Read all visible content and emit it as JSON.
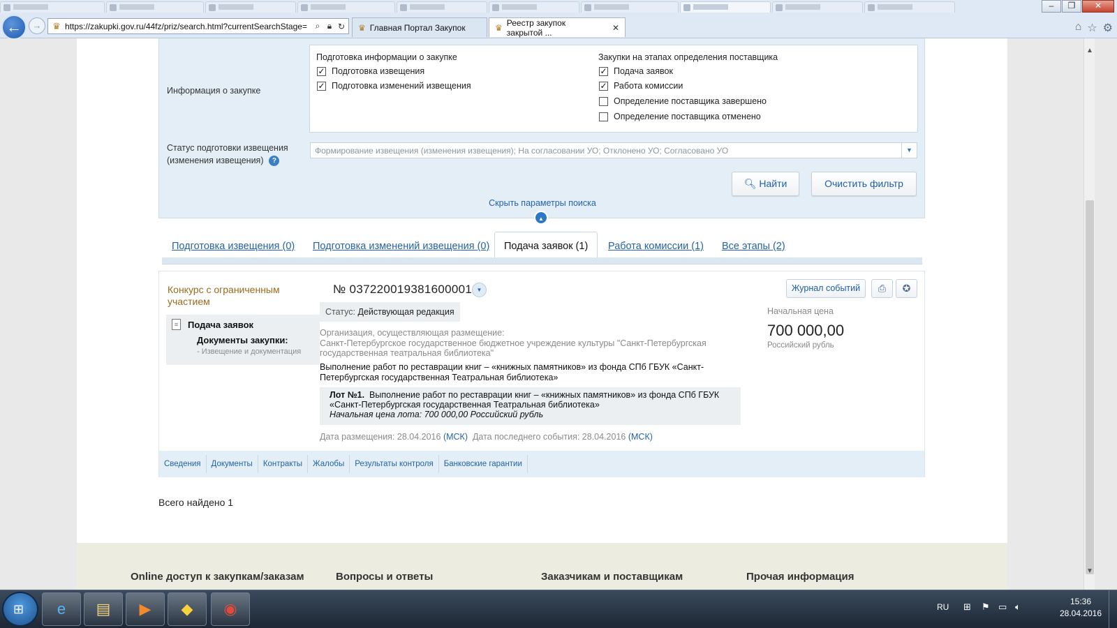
{
  "browser": {
    "url": "https://zakupki.gov.ru/44fz/priz/search.html?currentSearchStage=",
    "tabs": [
      {
        "label": "Главная Портал Закупок",
        "active": false
      },
      {
        "label": "Реестр закупок закрытой ...",
        "active": true
      }
    ],
    "window_controls": [
      "–",
      "❐",
      "✕"
    ]
  },
  "filters": {
    "info_label": "Информация о закупке",
    "group1_title": "Подготовка информации о закупке",
    "group1_items": [
      {
        "label": "Подготовка извещения",
        "checked": true
      },
      {
        "label": "Подготовка изменений извещения",
        "checked": true
      }
    ],
    "group2_title": "Закупки на этапах определения поставщика",
    "group2_items": [
      {
        "label": "Подача заявок",
        "checked": true
      },
      {
        "label": "Работа комиссии",
        "checked": true
      },
      {
        "label": "Определение поставщика завершено",
        "checked": false
      },
      {
        "label": "Определение поставщика отменено",
        "checked": false
      }
    ],
    "status_label_1": "Статус подготовки извещения",
    "status_label_2": "(изменения извещения)",
    "status_value": "Формирование извещения (изменения извещения); На согласовании УО; Отклонено УО; Согласовано УО",
    "find_button": "Найти",
    "clear_button": "Очистить фильтр",
    "hide_link": "Скрыть параметры поиска"
  },
  "result_tabs": [
    {
      "label": "Подготовка извещения (0)",
      "active": false
    },
    {
      "label": "Подготовка изменений извещения (0)",
      "active": false
    },
    {
      "label": "Подача заявок (1)",
      "active": true
    },
    {
      "label": "Работа комиссии (1)",
      "active": false
    },
    {
      "label": "Все этапы (2)",
      "active": false
    }
  ],
  "result": {
    "procedure_type": "Конкурс с ограниченным участием",
    "stage": "Подача заявок",
    "docs_title": "Документы закупки:",
    "docs_sub": "- Извещение и документация",
    "number": "№ 0372200193816000010",
    "status_key": "Статус:",
    "status_value": "Действующая редакция",
    "org_label": "Организация, осуществляющая размещение:",
    "org_name": "Санкт-Петербургское государственное бюджетное учреждение культуры \"Санкт-Петербургская государственная театральная библиотека\"",
    "object": "Выполнение работ по реставрации книг – «книжных памятников» из фонда СПб ГБУК «Санкт-Петербургская государственная Театральная библиотека»",
    "lot_label": "Лот №1.",
    "lot_text": "Выполнение работ по реставрации книг – «книжных памятников» из фонда СПб ГБУК «Санкт-Петербургская государственная Театральная библиотека»",
    "lot_price": "Начальная цена лота: 700 000,00 Российский рубль",
    "date_placed_label": "Дата размещения: 28.04.2016",
    "date_last_label": "Дата последнего события: 28.04.2016",
    "msk": "(МСК)",
    "journal_button": "Журнал событий",
    "price_label": "Начальная цена",
    "price": "700 000,00",
    "currency": "Российский рубль",
    "links": [
      "Сведения",
      "Документы",
      "Контракты",
      "Жалобы",
      "Результаты контроля",
      "Банковские гарантии"
    ]
  },
  "total": "Всего найдено 1",
  "footer": [
    "Online доступ к закупкам/заказам",
    "Вопросы и ответы",
    "Заказчикам и поставщикам",
    "Прочая информация"
  ],
  "taskbar": {
    "lang": "RU",
    "time": "15:36",
    "date": "28.04.2016"
  }
}
